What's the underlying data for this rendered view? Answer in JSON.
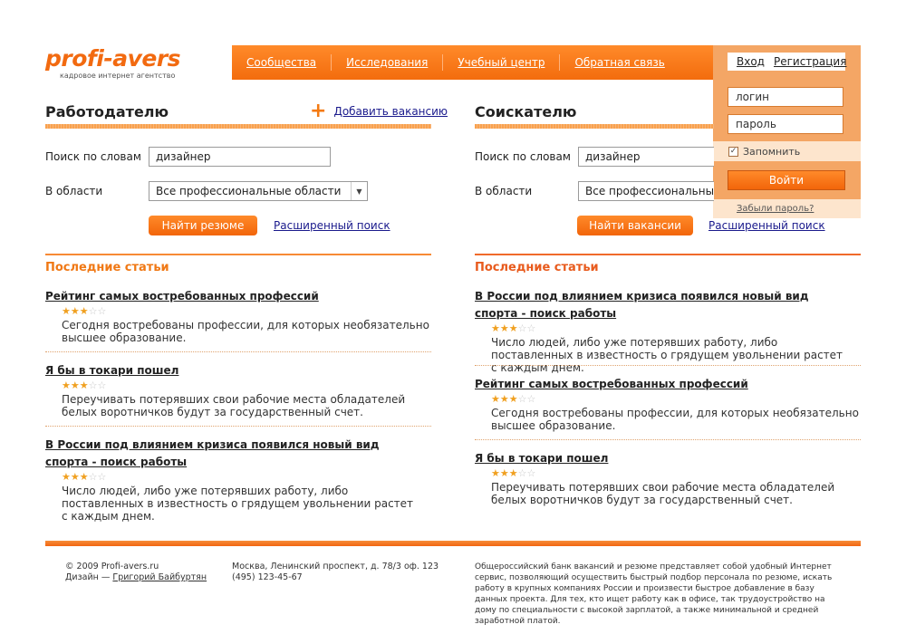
{
  "logo": {
    "name": "profi-avers",
    "tagline": "кадровое интернет агентство"
  },
  "nav": {
    "items": [
      "Сообщества",
      "Исследования",
      "Учебный центр",
      "Обратная связь"
    ]
  },
  "login": {
    "tab_login": "Вход",
    "tab_register": "Регистрация",
    "login_placeholder": "логин",
    "password_placeholder": "пароль",
    "remember": "Запомнить",
    "submit": "Войти",
    "forgot": "Забыли пароль?"
  },
  "employer": {
    "title": "Работодателю",
    "add_vacancy": "Добавить вакансию",
    "search_label": "Поиск по словам",
    "search_value": "дизайнер",
    "area_label": "В области",
    "area_value": "Все профессиональные области",
    "search_button": "Найти резюме",
    "advanced": "Расширенный поиск"
  },
  "seeker": {
    "title": "Соискателю",
    "search_label": "Поиск по словам",
    "search_value": "дизайнер",
    "area_label": "В области",
    "area_value": "Все профессиональные области",
    "search_button": "Найти вакансии",
    "advanced": "Расширенный поиск"
  },
  "articles_left": {
    "heading": "Последние статьи",
    "items": [
      {
        "title": "Рейтинг самых востребованных профессий",
        "desc": "Сегодня востребованы профессии, для которых необязательно высшее образование.",
        "rating": 3
      },
      {
        "title": "Я бы в токари пошел",
        "desc": "Переучивать потерявших свои рабочие места обладателей белых воротничков будут за государственный счет.",
        "rating": 3
      },
      {
        "title": "В России под влиянием кризиса появился новый вид спорта - поиск работы",
        "desc": "Число людей, либо уже потерявших работу, либо поставленных в известность о грядущем увольнении растет с каждым днем.",
        "rating": 3
      }
    ]
  },
  "articles_right": {
    "heading": "Последние статьи",
    "items": [
      {
        "title": "В России под влиянием кризиса появился новый вид спорта - поиск работы",
        "desc": "Число людей, либо уже потерявших работу, либо поставленных в известность о грядущем увольнении растет с каждым днем.",
        "rating": 3
      },
      {
        "title": "Рейтинг самых востребованных профессий",
        "desc": "Сегодня востребованы профессии, для которых необязательно высшее образование.",
        "rating": 3
      },
      {
        "title": "Я бы в токари пошел",
        "desc": "Переучивать потерявших свои рабочие места обладателей белых воротничков будут за государственный счет.",
        "rating": 3
      }
    ]
  },
  "footer": {
    "copyright": "© 2009  Profi-avers.ru",
    "design_prefix": "Дизайн — ",
    "designer": "Григорий Байбуртян",
    "address": "Москва, Ленинский проспект, д. 78/3 оф. 123",
    "phone": "(495) 123-45-67",
    "about": "Общероссийский банк вакансий и резюме представляет собой удобный Интернет сервис, позволяющий осуществить быстрый подбор персонала по резюме, искать работу в крупных компаниях России и произвести быстрое добавление в базу данных проекта. Для тех, кто ищет работу как в офисе, так трудоустройство на дому по специальности с высокой зарплатой, а также минимальной и средней заработной платой."
  }
}
